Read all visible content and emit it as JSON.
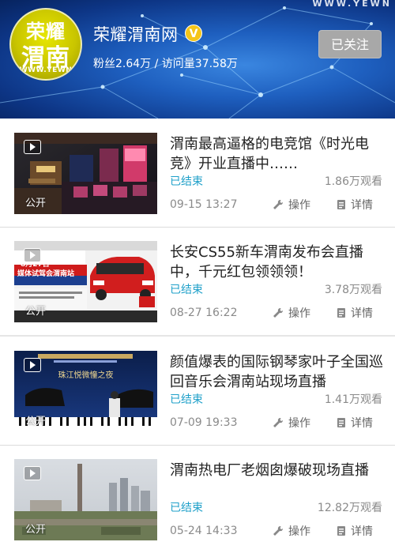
{
  "header": {
    "watermark": "WWW.YEWN",
    "logo": {
      "line1": "荣耀",
      "line2": "渭南",
      "line3": "WWW.YEWN"
    },
    "channel_name": "荣耀渭南网",
    "verified_mark": "V",
    "stats": "粉丝2.64万 / 访问量37.58万",
    "follow_label": "已关注"
  },
  "labels": {
    "public": "公开",
    "operate": "操作",
    "detail": "详情"
  },
  "icons": {
    "operate": "wrench-icon",
    "detail": "document-icon",
    "play": "play-icon"
  },
  "colors": {
    "status": "#1fa0c9",
    "header_bg": "#1e5fbf",
    "logo_bg": "#c9c500"
  },
  "items": [
    {
      "title": "渭南最高逼格的电竞馆《时光电竞》开业直播中……",
      "status": "已结束",
      "views": "1.86万观看",
      "time": "09-15 13:27"
    },
    {
      "title": "长安CS55新车渭南发布会直播中，千元红包领领领！",
      "status": "已结束",
      "views": "3.78万观看",
      "time": "08-27 16:22",
      "thumb_text": {
        "date": "8月27日",
        "headline": "媒体试驾会渭南站"
      }
    },
    {
      "title": "颜值爆表的国际钢琴家叶子全国巡回音乐会渭南站现场直播",
      "status": "已结束",
      "views": "1.41万观看",
      "time": "07-09 19:33",
      "thumb_text": {
        "headline": "珠江悦微憧之夜"
      }
    },
    {
      "title": "渭南热电厂老烟囱爆破现场直播",
      "status": "已结束",
      "views": "12.82万观看",
      "time": "05-24 14:33"
    }
  ]
}
